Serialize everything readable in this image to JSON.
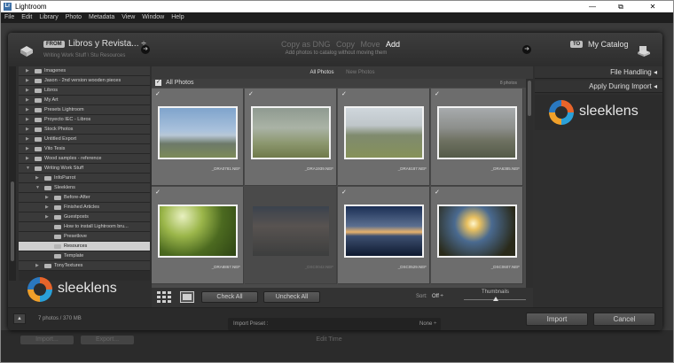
{
  "window": {
    "title": "Lightroom",
    "icon_text": "Lr",
    "controls": [
      "—",
      "⧉",
      "✕"
    ]
  },
  "menu": [
    "File",
    "Edit",
    "Library",
    "Photo",
    "Metadata",
    "View",
    "Window",
    "Help"
  ],
  "source": {
    "badge": "FROM",
    "name": "Libros y Revista... ÷",
    "path": "Writing Work Stuff \\ Stu Resources"
  },
  "modes": {
    "items": [
      "Copy as DNG",
      "Copy",
      "Move",
      "Add"
    ],
    "active": "Add",
    "description": "Add photos to catalog without moving them"
  },
  "destination": {
    "badge": "TO",
    "name": "My Catalog"
  },
  "folders": [
    {
      "label": "Imagenes",
      "level": 0,
      "expanded": false
    },
    {
      "label": "Jason - 2nd version wooden pieces",
      "level": 0,
      "expanded": false
    },
    {
      "label": "Libros",
      "level": 0,
      "expanded": false
    },
    {
      "label": "My Art",
      "level": 0,
      "expanded": false
    },
    {
      "label": "Presets Lightroom",
      "level": 0,
      "expanded": false
    },
    {
      "label": "Proyecto IEC - Libros",
      "level": 0,
      "expanded": false
    },
    {
      "label": "Stock Photos",
      "level": 0,
      "expanded": false
    },
    {
      "label": "Untitled Export",
      "level": 0,
      "expanded": false
    },
    {
      "label": "Vito Tesis",
      "level": 0,
      "expanded": false
    },
    {
      "label": "Wood samples - reference",
      "level": 0,
      "expanded": false
    },
    {
      "label": "Writing Work Stuff",
      "level": 0,
      "expanded": true
    },
    {
      "label": "InfoParrot",
      "level": 1,
      "expanded": false
    },
    {
      "label": "Sleeklens",
      "level": 1,
      "expanded": true
    },
    {
      "label": "Before-After",
      "level": 2,
      "expanded": false
    },
    {
      "label": "Finished Articles",
      "level": 2,
      "expanded": false
    },
    {
      "label": "Guestposts",
      "level": 2,
      "expanded": false
    },
    {
      "label": "How to install Lightroom bru...",
      "level": 2,
      "expanded": false
    },
    {
      "label": "Presetlove",
      "level": 2,
      "expanded": false
    },
    {
      "label": "Resources",
      "level": 2,
      "expanded": false,
      "selected": true
    },
    {
      "label": "Template",
      "level": 2,
      "expanded": false
    },
    {
      "label": "TonyTextures",
      "level": 1,
      "expanded": false
    }
  ],
  "brand": {
    "name": "sleeklens"
  },
  "grid": {
    "tabs": [
      "All Photos",
      "New Photos"
    ],
    "active_tab": "All Photos",
    "header": "All Photos",
    "count": "8 photos",
    "photos": [
      {
        "file": "_DRA0781.NEF",
        "checked": true,
        "scene": "castle"
      },
      {
        "file": "_DRA1939.NEF",
        "checked": true,
        "scene": "fog"
      },
      {
        "file": "_DRA6187.NEF",
        "checked": true,
        "scene": "valley"
      },
      {
        "file": "_DRA6385.NEF",
        "checked": true,
        "scene": "mountain"
      },
      {
        "file": "_DRA8867.NEF",
        "checked": true,
        "scene": "forest"
      },
      {
        "file": "_DSC0042.NEF",
        "checked": false,
        "scene": "sunrise"
      },
      {
        "file": "_DSC0529.NEF",
        "checked": true,
        "scene": "lake"
      },
      {
        "file": "_DSC0607.NEF",
        "checked": true,
        "scene": "sunstar"
      }
    ]
  },
  "toolbar": {
    "check_all": "Check All",
    "uncheck_all": "Uncheck All",
    "sort_label": "Sort:",
    "sort_value": "Off ÷",
    "thumbnails_label": "Thumbnails"
  },
  "right_panel": {
    "file_handling": "File Handling ◂",
    "apply_during_import": "Apply During Import ◂"
  },
  "footer": {
    "summary": "7 photos / 370 MB",
    "import_label": "Import",
    "cancel_label": "Cancel",
    "preset_label": "Import Preset :",
    "preset_value": "None ÷"
  },
  "background": {
    "import_btn": "Import...",
    "export_btn": "Export...",
    "edit_time": "Edit Time"
  },
  "colors": {
    "dialog_bg": "#2f2f2f",
    "grid_bg": "#4a4a4a",
    "cell_bg": "#6d6d6d",
    "selected_row": "#cfcfcf",
    "text": "#dcdcdc"
  }
}
